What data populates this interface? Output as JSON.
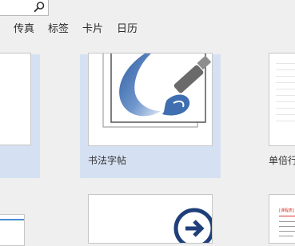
{
  "filters": [
    "传真",
    "标签",
    "卡片",
    "日历"
  ],
  "templates": [
    {
      "label": ""
    },
    {
      "label": "书法字帖",
      "selected": true
    },
    {
      "label": "单倍行"
    }
  ],
  "preview_doc": {
    "heading": "[课程表]"
  },
  "colors": {
    "selection": "#d5e1f2",
    "brush": "#3f6fb0",
    "arrow_icon": "#1f3f7a",
    "accent_red": "#d9342b"
  }
}
